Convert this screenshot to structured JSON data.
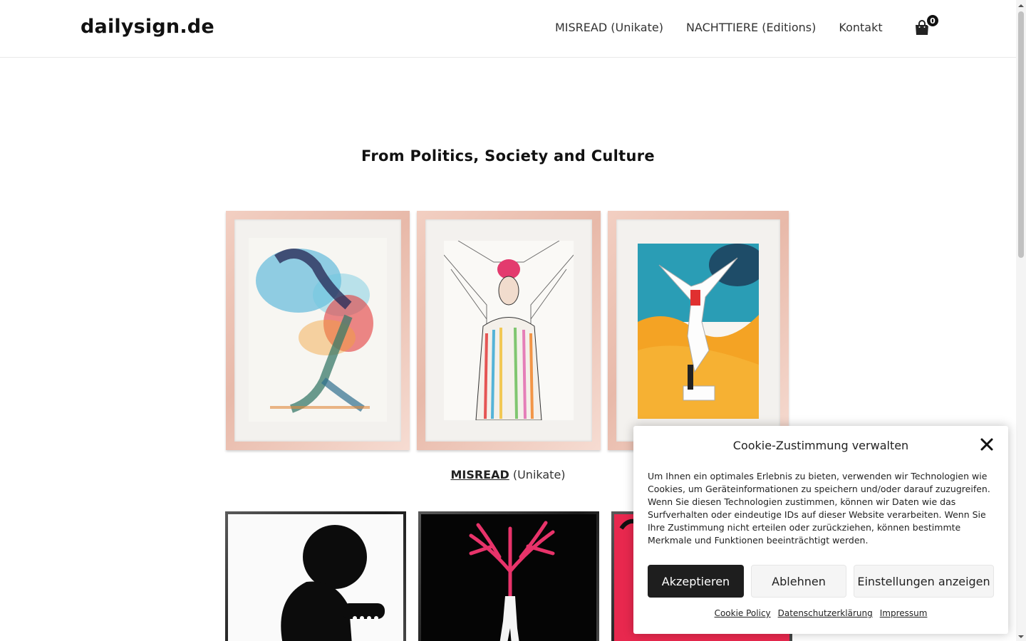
{
  "header": {
    "brand": "dailysign.de",
    "nav": [
      {
        "label": "MISREAD (Unikate)"
      },
      {
        "label": "NACHTTIERE (Editions)"
      },
      {
        "label": "Kontakt"
      }
    ],
    "cart_count": "0"
  },
  "main": {
    "title": "From Politics, Society and Culture",
    "gallery1_caption_link": "MISREAD",
    "gallery1_caption_rest": " (Unikate)",
    "gallery1_artworks": [
      {
        "name": "watercolor-two-figures"
      },
      {
        "name": "watercolor-man-in-striped-coat"
      },
      {
        "name": "watercolor-statue-on-orange"
      }
    ],
    "gallery2_artworks": [
      {
        "name": "silhouette-figure-with-tank"
      },
      {
        "name": "red-tree-legs"
      },
      {
        "name": "red-figure-partial"
      }
    ]
  },
  "cookie": {
    "title": "Cookie-Zustimmung verwalten",
    "text": "Um Ihnen ein optimales Erlebnis zu bieten, verwenden wir Technologien wie Cookies, um Geräteinformationen zu speichern und/oder darauf zuzugreifen. Wenn Sie diesen Technologien zustimmen, können wir Daten wie das Surfverhalten oder eindeutige IDs auf dieser Website verarbeiten. Wenn Sie Ihre Zustimmung nicht erteilen oder zurückziehen, können bestimmte Merkmale und Funktionen beeinträchtigt werden.",
    "accept": "Akzeptieren",
    "deny": "Ablehnen",
    "prefs": "Einstellungen anzeigen",
    "links": [
      "Cookie Policy",
      "Datenschutzerklärung",
      "Impressum"
    ]
  },
  "colors": {
    "accent_dark": "#1e1e1e",
    "frame_wood": "#e8b9a9",
    "art_red": "#e8336a"
  }
}
